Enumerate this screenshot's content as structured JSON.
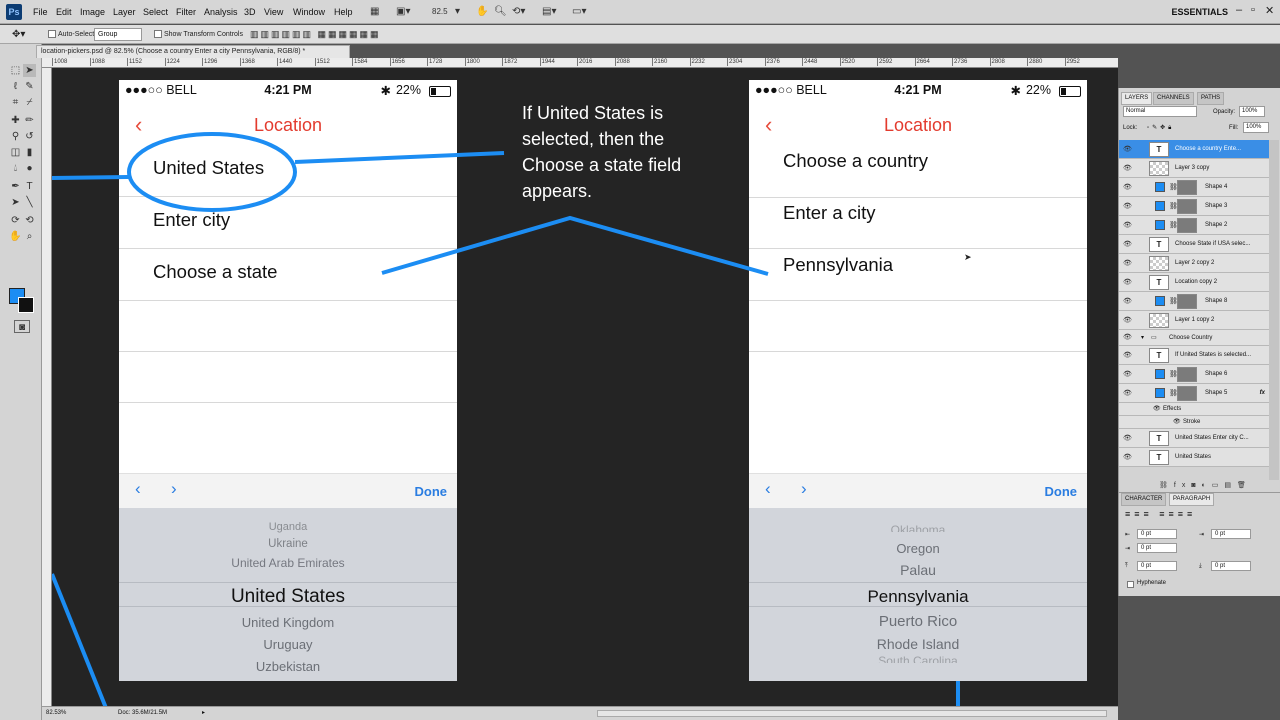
{
  "app": {
    "logo": "Ps"
  },
  "menubar": {
    "items": [
      "File",
      "Edit",
      "Image",
      "Layer",
      "Select",
      "Filter",
      "Analysis",
      "3D",
      "View",
      "Window",
      "Help"
    ],
    "zoom": "82.5",
    "workspace": "ESSENTIALS"
  },
  "options": {
    "auto_select": "Auto-Select:",
    "group": "Group",
    "show_transform": "Show Transform Controls"
  },
  "document": {
    "tab_title": "location-pickers.psd @ 82.5% (Choose a country Enter a city Pennsylvania, RGB/8) *"
  },
  "rulers": {
    "top": [
      "1008",
      "1088",
      "1152",
      "1224",
      "1296",
      "1368",
      "1440",
      "1512",
      "1584",
      "1656",
      "1728",
      "1800",
      "1872",
      "1944",
      "2016",
      "2088",
      "2160",
      "2232",
      "2304",
      "2376",
      "2448",
      "2520",
      "2592",
      "2664",
      "2736",
      "2808",
      "2880",
      "2952"
    ]
  },
  "status": {
    "zoom": "82.53%",
    "doc": "Doc: 35.6M/21.5M"
  },
  "phone1": {
    "carrier": "●●●○○ BELL",
    "time": "4:21 PM",
    "battery": "22%",
    "title": "Location",
    "rows": [
      "United States",
      "Enter city",
      "Choose a state"
    ],
    "done": "Done",
    "picker": [
      "Uganda",
      "Ukraine",
      "United Arab Emirates",
      "United States",
      "United Kingdom",
      "Uruguay",
      "Uzbekistan"
    ]
  },
  "phone2": {
    "carrier": "●●●○○ BELL",
    "time": "4:21 PM",
    "battery": "22%",
    "title": "Location",
    "rows": [
      "Choose a country",
      "Enter a city",
      "Pennsylvania"
    ],
    "done": "Done",
    "picker": [
      "Oklahoma",
      "Oregon",
      "Palau",
      "Pennsylvania",
      "Puerto Rico",
      "Rhode Island",
      "South Carolina"
    ]
  },
  "annotation": "If United States is selected, then the Choose a state field appears.",
  "layers_panel": {
    "tabs": [
      "LAYERS",
      "CHANNELS",
      "PATHS"
    ],
    "blend": "Normal",
    "opacity_label": "Opacity:",
    "opacity": "100%",
    "lock_label": "Lock:",
    "fill_label": "Fill:",
    "fill": "100%",
    "rows": [
      {
        "name": "Choose a country Ente...",
        "kind": "text"
      },
      {
        "name": "Layer 3 copy",
        "kind": "raster"
      },
      {
        "name": "Shape 4",
        "kind": "shape"
      },
      {
        "name": "Shape 3",
        "kind": "shape"
      },
      {
        "name": "Shape 2",
        "kind": "shape"
      },
      {
        "name": "Choose State if USA selec...",
        "kind": "text"
      },
      {
        "name": "Layer 2 copy 2",
        "kind": "raster"
      },
      {
        "name": "Location copy 2",
        "kind": "text"
      },
      {
        "name": "Shape 8",
        "kind": "shape"
      },
      {
        "name": "Layer 1 copy 2",
        "kind": "raster"
      },
      {
        "name": "Choose Country",
        "kind": "group"
      },
      {
        "name": "If United States is selected...",
        "kind": "text"
      },
      {
        "name": "Shape 6",
        "kind": "shape"
      },
      {
        "name": "Shape 5",
        "kind": "shape"
      },
      {
        "name": "Effects",
        "kind": "effect"
      },
      {
        "name": "Stroke",
        "kind": "effect"
      },
      {
        "name": "United States Enter city C...",
        "kind": "text"
      },
      {
        "name": "United States",
        "kind": "text"
      }
    ]
  },
  "paragraph_panel": {
    "tabs": [
      "CHARACTER",
      "PARAGRAPH"
    ],
    "fields": [
      "0 pt",
      "0 pt",
      "0 pt",
      "0 pt",
      "0 pt"
    ],
    "hyphenate": "Hyphenate"
  },
  "colors": {
    "accent": "#1c8df3",
    "ios_red": "#e33b2e",
    "ios_blue": "#2a7de1",
    "canvas": "#242424"
  }
}
